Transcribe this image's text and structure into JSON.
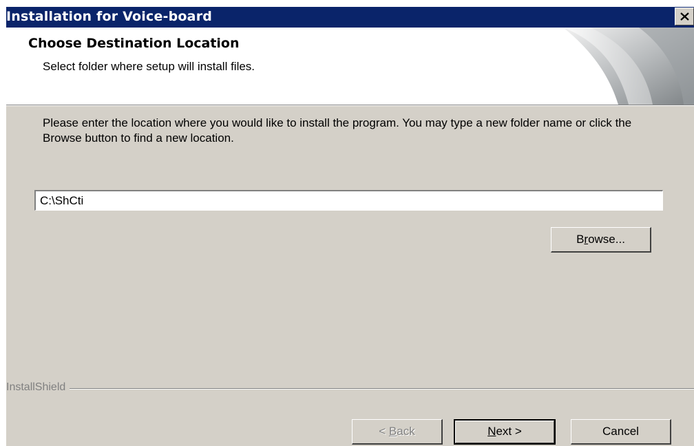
{
  "window": {
    "title": "Installation for Voice-board"
  },
  "header": {
    "title": "Choose Destination Location",
    "subtitle": "Select folder where setup will install files."
  },
  "body": {
    "intro": "Please enter the location where you would like to install the program.  You may type a new folder name or click the Browse button to find a new location."
  },
  "destination": {
    "value": "C:\\ShCti"
  },
  "buttons": {
    "browse": {
      "pre": "B",
      "key": "r",
      "post": "owse..."
    },
    "back": {
      "pre": "< ",
      "key": "B",
      "post": "ack"
    },
    "next": {
      "pre": "",
      "key": "N",
      "post": "ext >"
    },
    "cancel": "Cancel"
  },
  "footer": {
    "brand": "InstallShield"
  },
  "icons": {
    "close": "close-icon",
    "header_art": "installshield-page-curl-icon"
  },
  "colors": {
    "title_bar": "#0a246a",
    "dialog_face": "#d4d0c8",
    "disabled_text": "#808080"
  }
}
